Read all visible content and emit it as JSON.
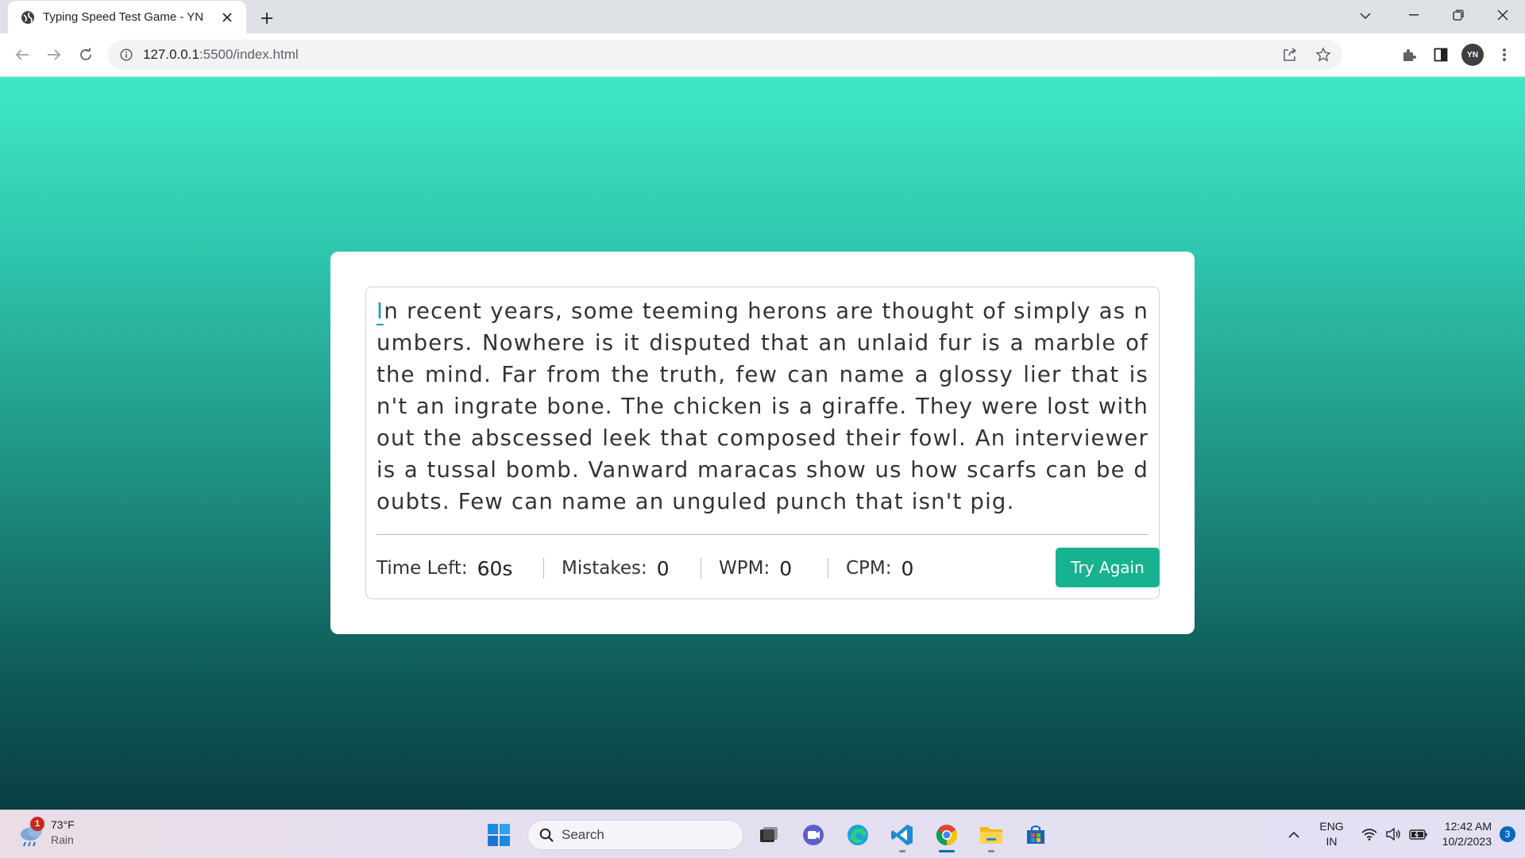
{
  "browser": {
    "tab_title": "Typing Speed Test Game - YN",
    "url_host": "127.0.0.1",
    "url_path": ":5500/index.html",
    "profile_initials": "YN"
  },
  "game": {
    "first_char": "I",
    "paragraph_rest": "n recent years, some teeming herons are thought of simply as numbers. Nowhere is it disputed that an unlaid fur is a marble of the mind. Far from the truth, few can name a glossy lier that isn't an ingrate bone. The chicken is a giraffe. They were lost without the abscessed leek that composed their fowl. An interviewer is a tussal bomb. Vanward maracas show us how scarfs can be doubts. Few can name an unguled punch that isn't pig.",
    "stats": {
      "time_label": "Time Left:",
      "time_value": "60s",
      "mistakes_label": "Mistakes:",
      "mistakes_value": "0",
      "wpm_label": "WPM:",
      "wpm_value": "0",
      "cpm_label": "CPM:",
      "cpm_value": "0"
    },
    "try_again_label": "Try Again",
    "accent_color": "#17b28f"
  },
  "taskbar": {
    "weather_badge": "1",
    "weather_temp": "73°F",
    "weather_desc": "Rain",
    "search_label": "Search",
    "lang_line1": "ENG",
    "lang_line2": "IN",
    "time": "12:42 AM",
    "date": "10/2/2023",
    "notification_count": "3"
  }
}
